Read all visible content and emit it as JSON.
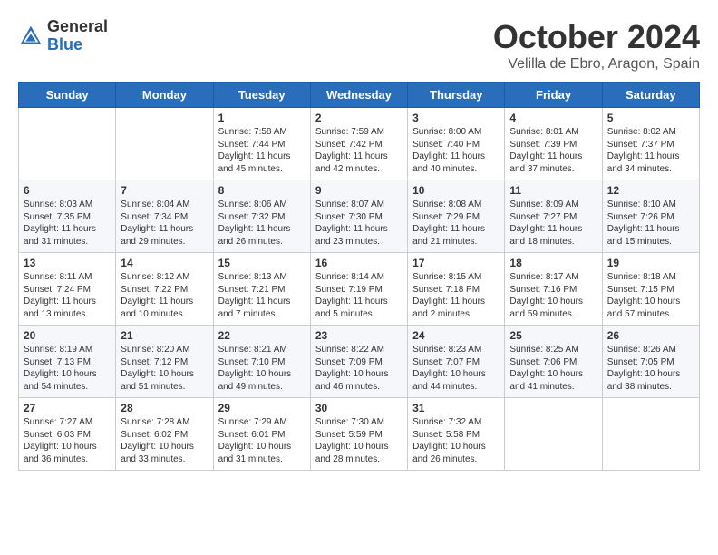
{
  "header": {
    "logo_general": "General",
    "logo_blue": "Blue",
    "month": "October 2024",
    "location": "Velilla de Ebro, Aragon, Spain"
  },
  "weekdays": [
    "Sunday",
    "Monday",
    "Tuesday",
    "Wednesday",
    "Thursday",
    "Friday",
    "Saturday"
  ],
  "weeks": [
    [
      {
        "day": "",
        "sunrise": "",
        "sunset": "",
        "daylight": ""
      },
      {
        "day": "",
        "sunrise": "",
        "sunset": "",
        "daylight": ""
      },
      {
        "day": "1",
        "sunrise": "Sunrise: 7:58 AM",
        "sunset": "Sunset: 7:44 PM",
        "daylight": "Daylight: 11 hours and 45 minutes."
      },
      {
        "day": "2",
        "sunrise": "Sunrise: 7:59 AM",
        "sunset": "Sunset: 7:42 PM",
        "daylight": "Daylight: 11 hours and 42 minutes."
      },
      {
        "day": "3",
        "sunrise": "Sunrise: 8:00 AM",
        "sunset": "Sunset: 7:40 PM",
        "daylight": "Daylight: 11 hours and 40 minutes."
      },
      {
        "day": "4",
        "sunrise": "Sunrise: 8:01 AM",
        "sunset": "Sunset: 7:39 PM",
        "daylight": "Daylight: 11 hours and 37 minutes."
      },
      {
        "day": "5",
        "sunrise": "Sunrise: 8:02 AM",
        "sunset": "Sunset: 7:37 PM",
        "daylight": "Daylight: 11 hours and 34 minutes."
      }
    ],
    [
      {
        "day": "6",
        "sunrise": "Sunrise: 8:03 AM",
        "sunset": "Sunset: 7:35 PM",
        "daylight": "Daylight: 11 hours and 31 minutes."
      },
      {
        "day": "7",
        "sunrise": "Sunrise: 8:04 AM",
        "sunset": "Sunset: 7:34 PM",
        "daylight": "Daylight: 11 hours and 29 minutes."
      },
      {
        "day": "8",
        "sunrise": "Sunrise: 8:06 AM",
        "sunset": "Sunset: 7:32 PM",
        "daylight": "Daylight: 11 hours and 26 minutes."
      },
      {
        "day": "9",
        "sunrise": "Sunrise: 8:07 AM",
        "sunset": "Sunset: 7:30 PM",
        "daylight": "Daylight: 11 hours and 23 minutes."
      },
      {
        "day": "10",
        "sunrise": "Sunrise: 8:08 AM",
        "sunset": "Sunset: 7:29 PM",
        "daylight": "Daylight: 11 hours and 21 minutes."
      },
      {
        "day": "11",
        "sunrise": "Sunrise: 8:09 AM",
        "sunset": "Sunset: 7:27 PM",
        "daylight": "Daylight: 11 hours and 18 minutes."
      },
      {
        "day": "12",
        "sunrise": "Sunrise: 8:10 AM",
        "sunset": "Sunset: 7:26 PM",
        "daylight": "Daylight: 11 hours and 15 minutes."
      }
    ],
    [
      {
        "day": "13",
        "sunrise": "Sunrise: 8:11 AM",
        "sunset": "Sunset: 7:24 PM",
        "daylight": "Daylight: 11 hours and 13 minutes."
      },
      {
        "day": "14",
        "sunrise": "Sunrise: 8:12 AM",
        "sunset": "Sunset: 7:22 PM",
        "daylight": "Daylight: 11 hours and 10 minutes."
      },
      {
        "day": "15",
        "sunrise": "Sunrise: 8:13 AM",
        "sunset": "Sunset: 7:21 PM",
        "daylight": "Daylight: 11 hours and 7 minutes."
      },
      {
        "day": "16",
        "sunrise": "Sunrise: 8:14 AM",
        "sunset": "Sunset: 7:19 PM",
        "daylight": "Daylight: 11 hours and 5 minutes."
      },
      {
        "day": "17",
        "sunrise": "Sunrise: 8:15 AM",
        "sunset": "Sunset: 7:18 PM",
        "daylight": "Daylight: 11 hours and 2 minutes."
      },
      {
        "day": "18",
        "sunrise": "Sunrise: 8:17 AM",
        "sunset": "Sunset: 7:16 PM",
        "daylight": "Daylight: 10 hours and 59 minutes."
      },
      {
        "day": "19",
        "sunrise": "Sunrise: 8:18 AM",
        "sunset": "Sunset: 7:15 PM",
        "daylight": "Daylight: 10 hours and 57 minutes."
      }
    ],
    [
      {
        "day": "20",
        "sunrise": "Sunrise: 8:19 AM",
        "sunset": "Sunset: 7:13 PM",
        "daylight": "Daylight: 10 hours and 54 minutes."
      },
      {
        "day": "21",
        "sunrise": "Sunrise: 8:20 AM",
        "sunset": "Sunset: 7:12 PM",
        "daylight": "Daylight: 10 hours and 51 minutes."
      },
      {
        "day": "22",
        "sunrise": "Sunrise: 8:21 AM",
        "sunset": "Sunset: 7:10 PM",
        "daylight": "Daylight: 10 hours and 49 minutes."
      },
      {
        "day": "23",
        "sunrise": "Sunrise: 8:22 AM",
        "sunset": "Sunset: 7:09 PM",
        "daylight": "Daylight: 10 hours and 46 minutes."
      },
      {
        "day": "24",
        "sunrise": "Sunrise: 8:23 AM",
        "sunset": "Sunset: 7:07 PM",
        "daylight": "Daylight: 10 hours and 44 minutes."
      },
      {
        "day": "25",
        "sunrise": "Sunrise: 8:25 AM",
        "sunset": "Sunset: 7:06 PM",
        "daylight": "Daylight: 10 hours and 41 minutes."
      },
      {
        "day": "26",
        "sunrise": "Sunrise: 8:26 AM",
        "sunset": "Sunset: 7:05 PM",
        "daylight": "Daylight: 10 hours and 38 minutes."
      }
    ],
    [
      {
        "day": "27",
        "sunrise": "Sunrise: 7:27 AM",
        "sunset": "Sunset: 6:03 PM",
        "daylight": "Daylight: 10 hours and 36 minutes."
      },
      {
        "day": "28",
        "sunrise": "Sunrise: 7:28 AM",
        "sunset": "Sunset: 6:02 PM",
        "daylight": "Daylight: 10 hours and 33 minutes."
      },
      {
        "day": "29",
        "sunrise": "Sunrise: 7:29 AM",
        "sunset": "Sunset: 6:01 PM",
        "daylight": "Daylight: 10 hours and 31 minutes."
      },
      {
        "day": "30",
        "sunrise": "Sunrise: 7:30 AM",
        "sunset": "Sunset: 5:59 PM",
        "daylight": "Daylight: 10 hours and 28 minutes."
      },
      {
        "day": "31",
        "sunrise": "Sunrise: 7:32 AM",
        "sunset": "Sunset: 5:58 PM",
        "daylight": "Daylight: 10 hours and 26 minutes."
      },
      {
        "day": "",
        "sunrise": "",
        "sunset": "",
        "daylight": ""
      },
      {
        "day": "",
        "sunrise": "",
        "sunset": "",
        "daylight": ""
      }
    ]
  ]
}
